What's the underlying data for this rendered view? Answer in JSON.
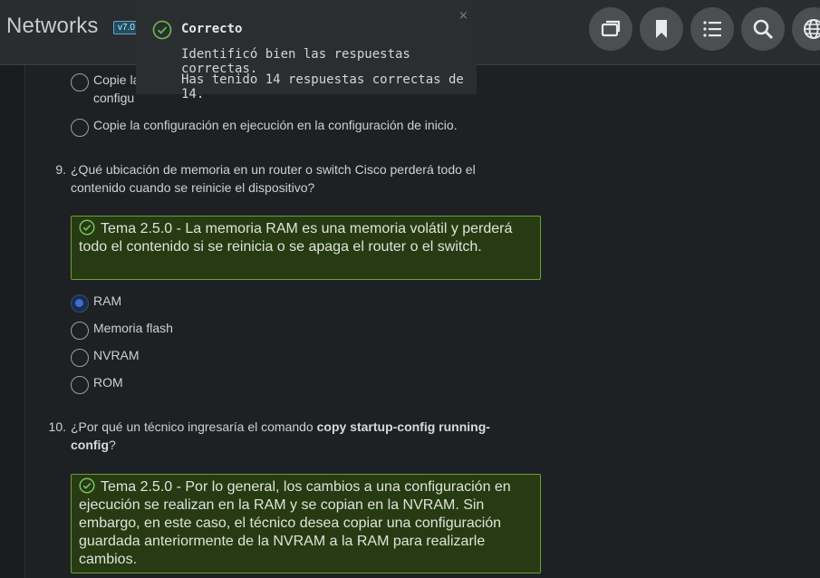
{
  "header": {
    "brand": "Networks",
    "version": "v7.0",
    "buttons": [
      "slides-icon",
      "bookmark-icon",
      "list-icon",
      "search-icon",
      "globe-icon"
    ]
  },
  "toast": {
    "title": "Correcto",
    "close": "×",
    "line1": "Identificó bien las respuestas correctas.",
    "line2": "Has tenido 14 respuestas correctas de 14."
  },
  "prev_options": [
    {
      "line1": "Copie la",
      "line2": "configu"
    },
    {
      "line1": "Copie la configuración en ejecución en la configuración de inicio."
    }
  ],
  "q9": {
    "number": "9.",
    "text": "¿Qué ubicación de memoria en un router o switch Cisco perderá todo el contenido cuando se reinicie el dispositivo?",
    "feedback": "Tema 2.5.0 - La memoria RAM es una memoria volátil y perderá todo el contenido si se reinicia o se apaga el router o el switch.",
    "options": [
      "RAM",
      "Memoria flash",
      "NVRAM",
      "ROM"
    ],
    "selected_index": 0
  },
  "q10": {
    "number": "10.",
    "text_before": "¿Por qué un técnico ingresaría el comando ",
    "text_bold": "copy startup-config running-config",
    "text_after": "?",
    "feedback": "Tema 2.5.0 - Por lo general, los cambios a una configuración en ejecución se realizan en la RAM y se copian en la NVRAM. Sin embargo, en este caso, el técnico desea copiar una configuración guardada anteriormente de la NVRAM a la RAM para realizarle cambios."
  },
  "colors": {
    "background": "#1f2022",
    "header": "#2a2c2f",
    "feedback_bg": "#263b12",
    "feedback_border": "#6d9c3e",
    "check_green": "#5fb548",
    "selected_radio": "#3a70c8"
  }
}
